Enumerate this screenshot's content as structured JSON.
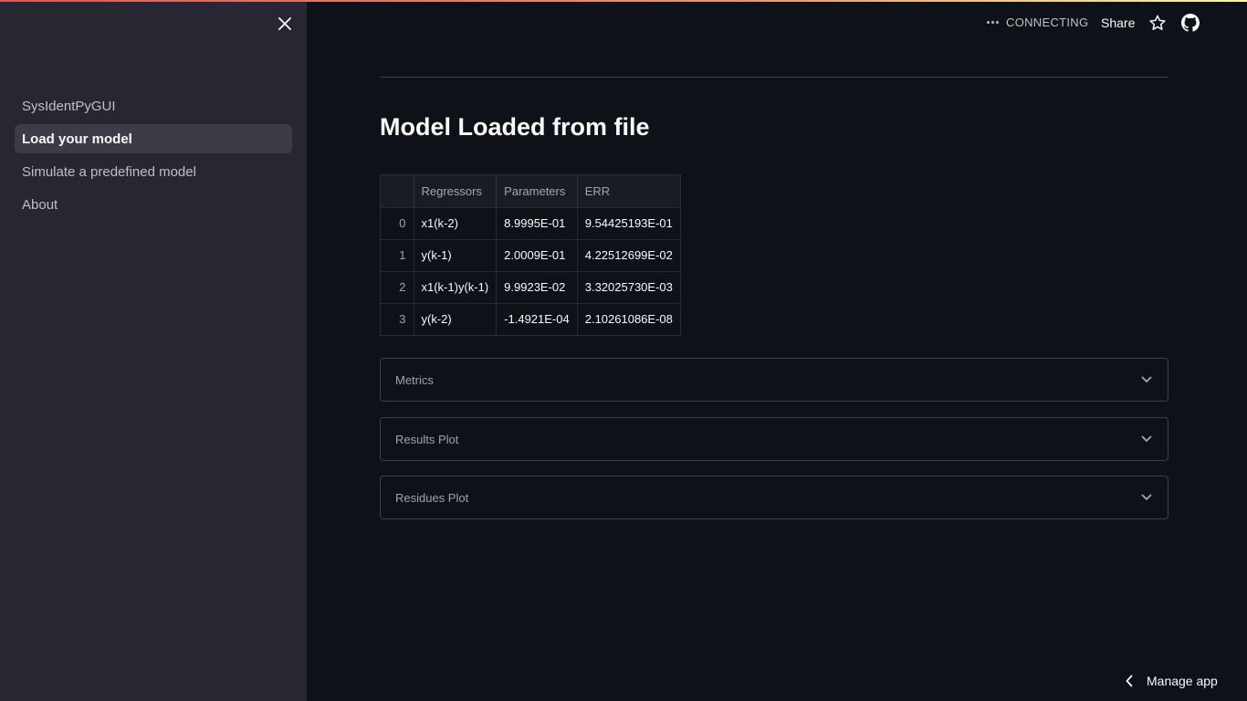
{
  "header": {
    "status_text": "CONNECTING",
    "share_label": "Share",
    "star_icon": "star-icon",
    "github_icon": "github-icon"
  },
  "sidebar": {
    "close_icon": "close-icon",
    "items": [
      {
        "label": "SysIdentPyGUI",
        "active": false
      },
      {
        "label": "Load your model",
        "active": true
      },
      {
        "label": "Simulate a predefined model",
        "active": false
      },
      {
        "label": "About",
        "active": false
      }
    ]
  },
  "main": {
    "title": "Model Loaded from file",
    "table": {
      "columns": [
        "",
        "Regressors",
        "Parameters",
        "ERR"
      ],
      "rows": [
        {
          "index": "0",
          "regressor": "x1(k-2)",
          "parameter": "8.9995E-01",
          "err": "9.54425193E-01"
        },
        {
          "index": "1",
          "regressor": "y(k-1)",
          "parameter": "2.0009E-01",
          "err": "4.22512699E-02"
        },
        {
          "index": "2",
          "regressor": "x1(k-1)y(k-1)",
          "parameter": "9.9923E-02",
          "err": "3.32025730E-03"
        },
        {
          "index": "3",
          "regressor": "y(k-2)",
          "parameter": "-1.4921E-04",
          "err": "2.10261086E-08"
        }
      ]
    },
    "expanders": [
      {
        "label": "Metrics"
      },
      {
        "label": "Results Plot"
      },
      {
        "label": "Residues Plot"
      }
    ]
  },
  "footer": {
    "manage_label": "Manage app"
  },
  "colors": {
    "background": "#0e1117",
    "sidebar": "#262730",
    "active_item": "#3b3c46",
    "accent": "#ff4b4b"
  }
}
